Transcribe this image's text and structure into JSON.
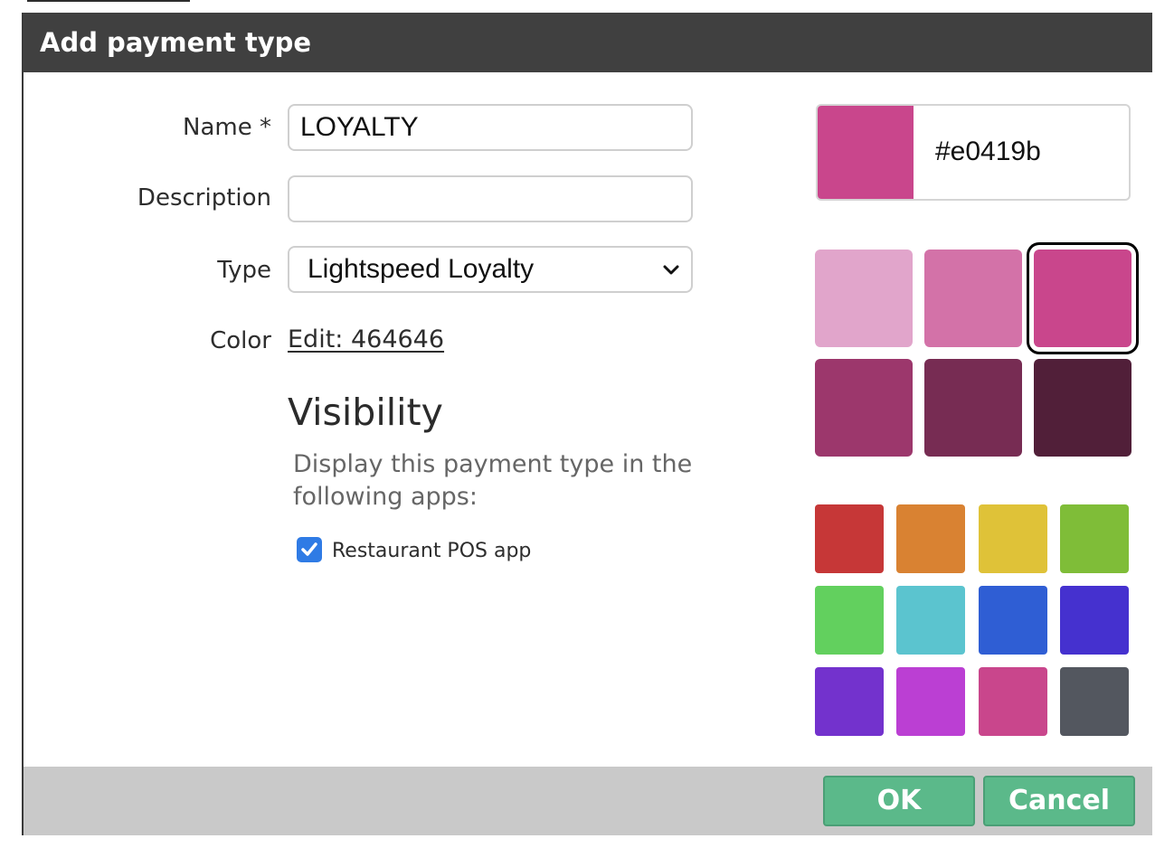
{
  "dialog": {
    "title": "Add payment type"
  },
  "form": {
    "name_label": "Name *",
    "name_value": "LOYALTY",
    "description_label": "Description",
    "description_value": "",
    "type_label": "Type",
    "type_value": "Lightspeed Loyalty",
    "color_label": "Color",
    "color_link": "Edit: 464646"
  },
  "visibility": {
    "heading": "Visibility",
    "description": "Display this payment type in the following apps:",
    "option_label": "Restaurant POS app",
    "option_checked": true
  },
  "color_picker": {
    "preview_color": "#c9468c",
    "hex_value": "#e0419b",
    "shades": [
      "#e1a5cb",
      "#d372a8",
      "#c9468c",
      "#9c376c",
      "#772c53",
      "#511f39"
    ],
    "selected_shade_index": 2,
    "base_colors": [
      "#c63737",
      "#d98232",
      "#dfc238",
      "#7fbd38",
      "#62d05e",
      "#5bc4cf",
      "#2f5ed4",
      "#4531cf",
      "#7332cd",
      "#bb3fd3",
      "#c9468c",
      "#53575f"
    ]
  },
  "footer": {
    "ok_label": "OK",
    "cancel_label": "Cancel",
    "button_color": "#5bb98a"
  }
}
